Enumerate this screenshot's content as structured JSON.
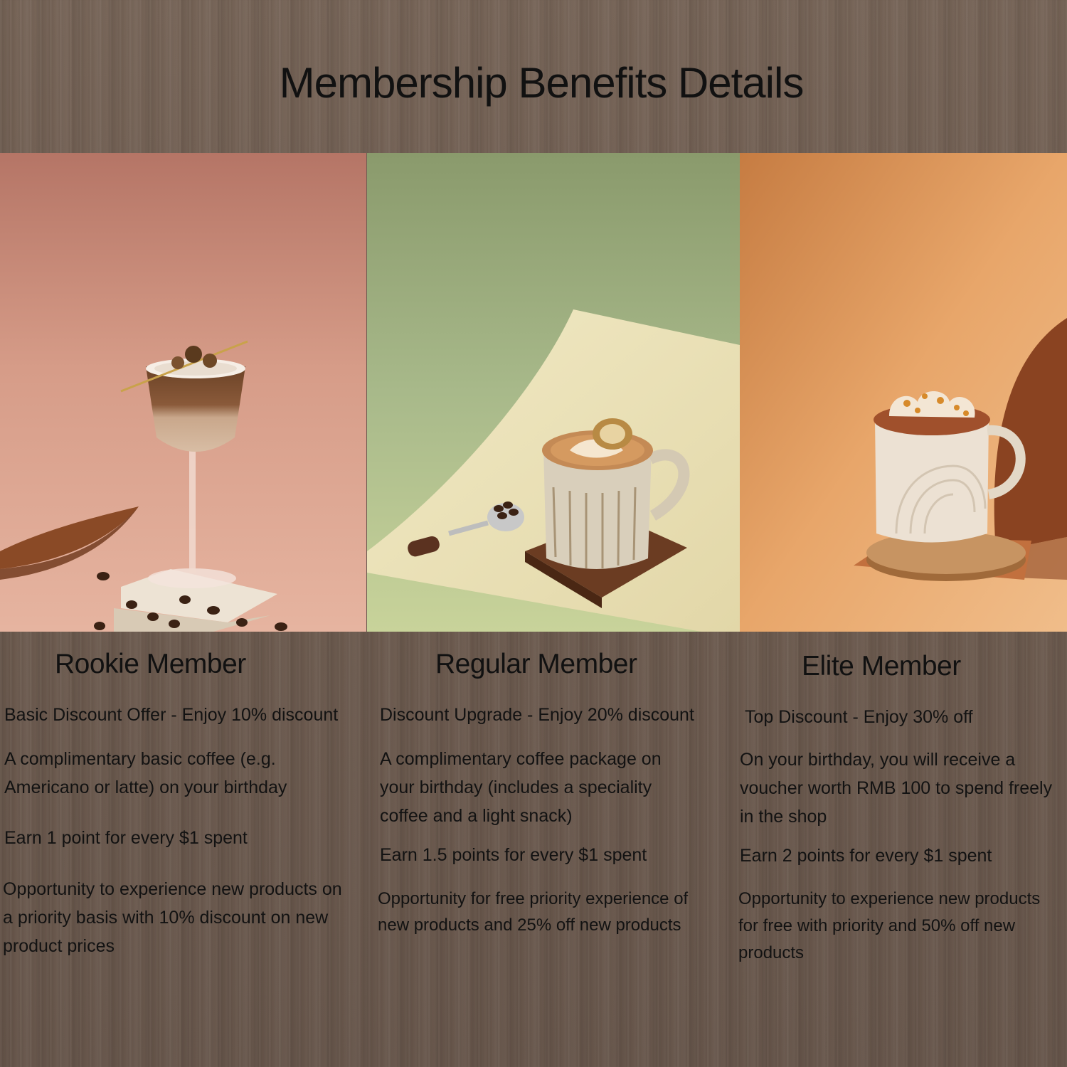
{
  "page": {
    "title": "Membership Benefits Details"
  },
  "tiers": [
    {
      "name": "Rookie Member",
      "image_icon": "cocktail-glass-coffee-photo",
      "benefits": [
        "Basic Discount Offer - Enjoy 10% discount",
        "A complimentary basic coffee (e.g. Americano or latte) on your birthday",
        "Earn 1 point for every $1 spent",
        "Opportunity to experience new products on a priority basis with 10% discount on new product prices"
      ]
    },
    {
      "name": "Regular Member",
      "image_icon": "latte-mug-photo",
      "benefits": [
        "Discount Upgrade - Enjoy 20% discount",
        "A complimentary coffee package on your birthday (includes a speciality coffee and a light snack)",
        "Earn 1.5 points for every $1 spent",
        "Opportunity for free priority experience of new products and 25% off new products"
      ]
    },
    {
      "name": "Elite Member",
      "image_icon": "whipped-cream-mug-photo",
      "benefits": [
        "Top Discount - Enjoy 30% off",
        "On your birthday, you will receive a voucher worth RMB 100 to spend freely in the shop",
        "Earn 2 points for every $1 spent",
        "Opportunity to experience new products for free with priority and 50% off new products"
      ]
    }
  ],
  "colors": {
    "background_wood": "#6e5c50",
    "rookie_backdrop": "#d9a08c",
    "regular_backdrop": "#a6b886",
    "elite_backdrop": "#e6a268",
    "text": "#111111"
  }
}
